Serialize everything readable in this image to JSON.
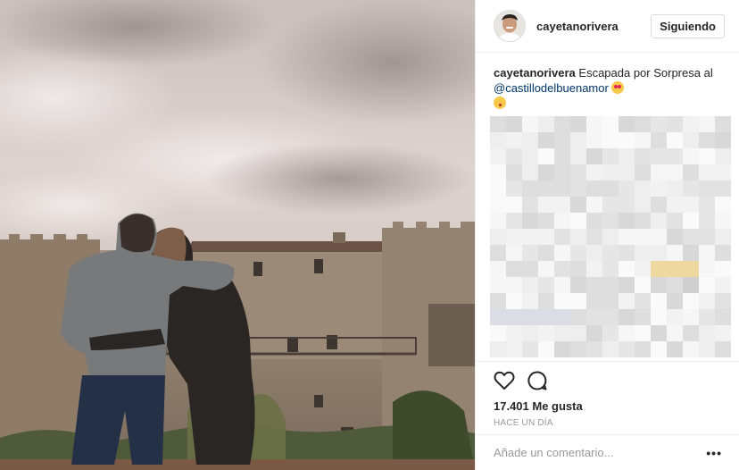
{
  "post": {
    "username": "cayetanorivera",
    "follow_label": "Siguiendo",
    "caption": {
      "username": "cayetanorivera",
      "text": " Escapada por Sorpresa al ",
      "mention": "@castillodelbuenamor",
      "emojis": [
        "heart-eyes-emoji",
        "kiss-emoji"
      ]
    },
    "likes": "17.401 Me gusta",
    "timestamp": "HACE UN DÍA",
    "comment_placeholder": "Añade un comentario...",
    "more_label": "•••",
    "icons": [
      "heart-icon",
      "comment-icon"
    ]
  },
  "colors": {
    "accent_link": "#003569",
    "text": "#262626",
    "muted": "#999999",
    "divider": "#efefef"
  }
}
